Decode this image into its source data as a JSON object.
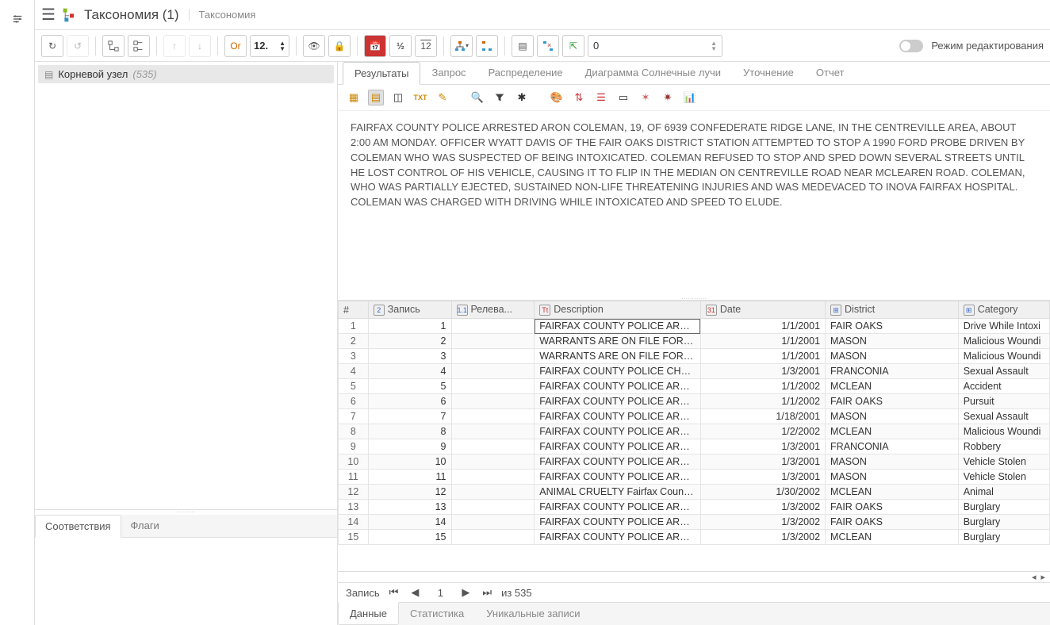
{
  "header": {
    "title": "Таксономия (1)",
    "subtitle": "Таксономия"
  },
  "toolbar": {
    "spinner_value": "12.",
    "or_label": "Or",
    "num_input": "0",
    "edit_mode_label": "Режим редактирования"
  },
  "sidebar": {
    "root_label": "Корневой узел",
    "root_count": "(535)",
    "tabs": {
      "matches": "Соответствия",
      "flags": "Флаги"
    }
  },
  "main_tabs": {
    "results": "Результаты",
    "query": "Запрос",
    "distribution": "Распределение",
    "sunburst": "Диаграмма Солнечные лучи",
    "refine": "Уточнение",
    "report": "Отчет"
  },
  "detail_text": "FAIRFAX COUNTY POLICE ARRESTED ARON COLEMAN, 19, OF 6939 CONFEDERATE RIDGE LANE, IN THE CENTREVILLE AREA, ABOUT 2:00 AM MONDAY. OFFICER WYATT DAVIS OF THE FAIR OAKS DISTRICT STATION ATTEMPTED TO STOP A 1990 FORD PROBE DRIVEN BY COLEMAN WHO WAS SUSPECTED OF BEING INTOXICATED. COLEMAN REFUSED TO STOP AND SPED DOWN SEVERAL STREETS UNTIL HE LOST CONTROL OF HIS VEHICLE, CAUSING IT TO FLIP IN THE MEDIAN ON CENTREVILLE ROAD NEAR MCLEAREN ROAD. COLEMAN, WHO WAS PARTIALLY EJECTED, SUSTAINED NON-LIFE THREATENING INJURIES AND WAS MEDEVACED TO INOVA FAIRFAX HOSPITAL. COLEMAN WAS CHARGED WITH DRIVING WHILE INTOXICATED AND SPEED TO ELUDE.",
  "columns": {
    "num": "#",
    "record": "Запись",
    "relevance": "Релева...",
    "description": "Description",
    "date": "Date",
    "district": "District",
    "category": "Category"
  },
  "rows": [
    {
      "n": "1",
      "rec": "1",
      "desc": "FAIRFAX COUNTY POLICE ARRESTE",
      "date": "1/1/2001",
      "district": "FAIR OAKS",
      "category": "Drive While Intoxi"
    },
    {
      "n": "2",
      "rec": "2",
      "desc": "WARRANTS ARE ON FILE FOR EDUA",
      "date": "1/1/2001",
      "district": "MASON",
      "category": "Malicious Woundi"
    },
    {
      "n": "3",
      "rec": "3",
      "desc": "WARRANTS ARE ON FILE FOR EDUA",
      "date": "1/1/2001",
      "district": "MASON",
      "category": "Malicious Woundi"
    },
    {
      "n": "4",
      "rec": "4",
      "desc": "FAIRFAX COUNTY POLICE CHARGE",
      "date": "1/3/2001",
      "district": "FRANCONIA",
      "category": "Sexual Assault"
    },
    {
      "n": "5",
      "rec": "5",
      "desc": "FAIRFAX COUNTY POLICE ARE INVE",
      "date": "1/1/2002",
      "district": "MCLEAN",
      "category": "Accident"
    },
    {
      "n": "6",
      "rec": "6",
      "desc": "FAIRFAX COUNTY POLICE ARRESTE",
      "date": "1/1/2002",
      "district": "FAIR OAKS",
      "category": "Pursuit"
    },
    {
      "n": "7",
      "rec": "7",
      "desc": "FAIRFAX COUNTY POLICE ARRESTE",
      "date": "1/18/2001",
      "district": "MASON",
      "category": "Sexual Assault"
    },
    {
      "n": "8",
      "rec": "8",
      "desc": "FAIRFAX COUNTY POLICE ARE INVE",
      "date": "1/2/2002",
      "district": "MCLEAN",
      "category": "Malicious Woundi"
    },
    {
      "n": "9",
      "rec": "9",
      "desc": "FAIRFAX COUNTY POLICE ARRESTE",
      "date": "1/3/2001",
      "district": "FRANCONIA",
      "category": "Robbery"
    },
    {
      "n": "10",
      "rec": "10",
      "desc": "FAIRFAX COUNTY POLICE ARRESTE",
      "date": "1/3/2001",
      "district": "MASON",
      "category": "Vehicle Stolen"
    },
    {
      "n": "11",
      "rec": "11",
      "desc": "FAIRFAX COUNTY POLICE ARRESTE",
      "date": "1/3/2001",
      "district": "MASON",
      "category": "Vehicle Stolen"
    },
    {
      "n": "12",
      "rec": "12",
      "desc": "ANIMAL CRUELTY Fairfax County P",
      "date": "1/30/2002",
      "district": "MCLEAN",
      "category": "Animal"
    },
    {
      "n": "13",
      "rec": "13",
      "desc": "FAIRFAX COUNTY POLICE ARE INVE",
      "date": "1/3/2002",
      "district": "FAIR OAKS",
      "category": "Burglary"
    },
    {
      "n": "14",
      "rec": "14",
      "desc": "FAIRFAX COUNTY POLICE ARRESTE",
      "date": "1/3/2002",
      "district": "FAIR OAKS",
      "category": "Burglary"
    },
    {
      "n": "15",
      "rec": "15",
      "desc": "FAIRFAX COUNTY POLICE ARRESTE",
      "date": "1/3/2002",
      "district": "MCLEAN",
      "category": "Burglary"
    }
  ],
  "pager": {
    "label": "Запись",
    "current": "1",
    "of": "из 535"
  },
  "bottom_tabs": {
    "data": "Данные",
    "stats": "Статистика",
    "unique": "Уникальные записи"
  }
}
